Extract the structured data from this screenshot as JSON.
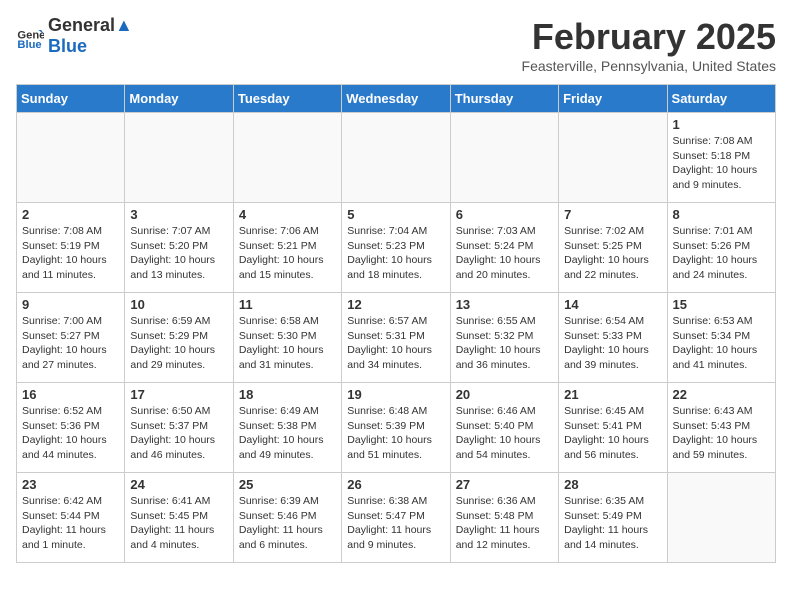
{
  "header": {
    "logo_general": "General",
    "logo_blue": "Blue",
    "month": "February 2025",
    "location": "Feasterville, Pennsylvania, United States"
  },
  "weekdays": [
    "Sunday",
    "Monday",
    "Tuesday",
    "Wednesday",
    "Thursday",
    "Friday",
    "Saturday"
  ],
  "weeks": [
    [
      {
        "day": "",
        "info": ""
      },
      {
        "day": "",
        "info": ""
      },
      {
        "day": "",
        "info": ""
      },
      {
        "day": "",
        "info": ""
      },
      {
        "day": "",
        "info": ""
      },
      {
        "day": "",
        "info": ""
      },
      {
        "day": "1",
        "info": "Sunrise: 7:08 AM\nSunset: 5:18 PM\nDaylight: 10 hours and 9 minutes."
      }
    ],
    [
      {
        "day": "2",
        "info": "Sunrise: 7:08 AM\nSunset: 5:19 PM\nDaylight: 10 hours and 11 minutes."
      },
      {
        "day": "3",
        "info": "Sunrise: 7:07 AM\nSunset: 5:20 PM\nDaylight: 10 hours and 13 minutes."
      },
      {
        "day": "4",
        "info": "Sunrise: 7:06 AM\nSunset: 5:21 PM\nDaylight: 10 hours and 15 minutes."
      },
      {
        "day": "5",
        "info": "Sunrise: 7:04 AM\nSunset: 5:23 PM\nDaylight: 10 hours and 18 minutes."
      },
      {
        "day": "6",
        "info": "Sunrise: 7:03 AM\nSunset: 5:24 PM\nDaylight: 10 hours and 20 minutes."
      },
      {
        "day": "7",
        "info": "Sunrise: 7:02 AM\nSunset: 5:25 PM\nDaylight: 10 hours and 22 minutes."
      },
      {
        "day": "8",
        "info": "Sunrise: 7:01 AM\nSunset: 5:26 PM\nDaylight: 10 hours and 24 minutes."
      }
    ],
    [
      {
        "day": "9",
        "info": "Sunrise: 7:00 AM\nSunset: 5:27 PM\nDaylight: 10 hours and 27 minutes."
      },
      {
        "day": "10",
        "info": "Sunrise: 6:59 AM\nSunset: 5:29 PM\nDaylight: 10 hours and 29 minutes."
      },
      {
        "day": "11",
        "info": "Sunrise: 6:58 AM\nSunset: 5:30 PM\nDaylight: 10 hours and 31 minutes."
      },
      {
        "day": "12",
        "info": "Sunrise: 6:57 AM\nSunset: 5:31 PM\nDaylight: 10 hours and 34 minutes."
      },
      {
        "day": "13",
        "info": "Sunrise: 6:55 AM\nSunset: 5:32 PM\nDaylight: 10 hours and 36 minutes."
      },
      {
        "day": "14",
        "info": "Sunrise: 6:54 AM\nSunset: 5:33 PM\nDaylight: 10 hours and 39 minutes."
      },
      {
        "day": "15",
        "info": "Sunrise: 6:53 AM\nSunset: 5:34 PM\nDaylight: 10 hours and 41 minutes."
      }
    ],
    [
      {
        "day": "16",
        "info": "Sunrise: 6:52 AM\nSunset: 5:36 PM\nDaylight: 10 hours and 44 minutes."
      },
      {
        "day": "17",
        "info": "Sunrise: 6:50 AM\nSunset: 5:37 PM\nDaylight: 10 hours and 46 minutes."
      },
      {
        "day": "18",
        "info": "Sunrise: 6:49 AM\nSunset: 5:38 PM\nDaylight: 10 hours and 49 minutes."
      },
      {
        "day": "19",
        "info": "Sunrise: 6:48 AM\nSunset: 5:39 PM\nDaylight: 10 hours and 51 minutes."
      },
      {
        "day": "20",
        "info": "Sunrise: 6:46 AM\nSunset: 5:40 PM\nDaylight: 10 hours and 54 minutes."
      },
      {
        "day": "21",
        "info": "Sunrise: 6:45 AM\nSunset: 5:41 PM\nDaylight: 10 hours and 56 minutes."
      },
      {
        "day": "22",
        "info": "Sunrise: 6:43 AM\nSunset: 5:43 PM\nDaylight: 10 hours and 59 minutes."
      }
    ],
    [
      {
        "day": "23",
        "info": "Sunrise: 6:42 AM\nSunset: 5:44 PM\nDaylight: 11 hours and 1 minute."
      },
      {
        "day": "24",
        "info": "Sunrise: 6:41 AM\nSunset: 5:45 PM\nDaylight: 11 hours and 4 minutes."
      },
      {
        "day": "25",
        "info": "Sunrise: 6:39 AM\nSunset: 5:46 PM\nDaylight: 11 hours and 6 minutes."
      },
      {
        "day": "26",
        "info": "Sunrise: 6:38 AM\nSunset: 5:47 PM\nDaylight: 11 hours and 9 minutes."
      },
      {
        "day": "27",
        "info": "Sunrise: 6:36 AM\nSunset: 5:48 PM\nDaylight: 11 hours and 12 minutes."
      },
      {
        "day": "28",
        "info": "Sunrise: 6:35 AM\nSunset: 5:49 PM\nDaylight: 11 hours and 14 minutes."
      },
      {
        "day": "",
        "info": ""
      }
    ]
  ]
}
